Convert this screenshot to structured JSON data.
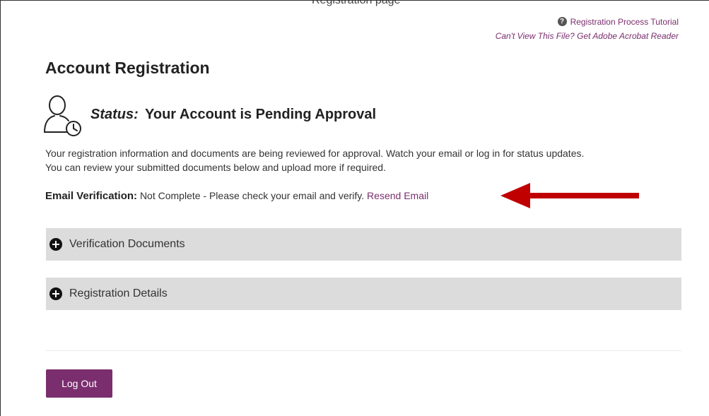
{
  "header": {
    "cut_text": "Registration page",
    "tutorial_link": "Registration Process Tutorial",
    "acrobat_link": "Can't View This File? Get Adobe Acrobat Reader"
  },
  "title": "Account Registration",
  "status": {
    "label": "Status:",
    "value": "Your Account is Pending Approval"
  },
  "description": {
    "line1": "Your registration information and documents are being reviewed for approval. Watch your email or log in for status updates.",
    "line2": "You can review your submitted documents below and upload more if required."
  },
  "email_verification": {
    "label": "Email Verification:",
    "text": "Not Complete - Please check your email and verify.",
    "link": "Resend Email"
  },
  "sections": [
    {
      "label": "Verification Documents"
    },
    {
      "label": "Registration Details"
    }
  ],
  "buttons": {
    "logout": "Log Out"
  },
  "icons": {
    "help": "help-circle-icon",
    "status": "user-clock-icon",
    "expand": "plus-circle-icon",
    "annotation": "red-arrow-icon"
  },
  "colors": {
    "accent": "#7a2e6e",
    "accordion_bg": "#dddcdc",
    "arrow": "#c00000"
  }
}
